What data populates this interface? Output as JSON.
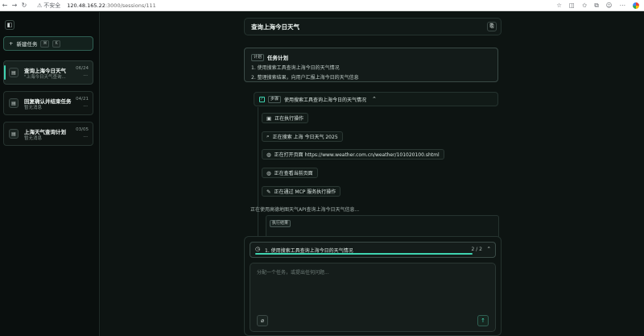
{
  "browser": {
    "security_label": "不安全",
    "url_host": "120.48.165.22",
    "url_rest": ":3000/sessions/111"
  },
  "sidebar": {
    "new_task_label": "新建任务",
    "shortcut_keys": [
      "⌘",
      "K"
    ],
    "sessions": [
      {
        "title": "查询上海今日天气",
        "subtitle": "\"上海今日天气查询...",
        "date": "06/24",
        "more": "...",
        "active": true
      },
      {
        "title": "回复确认并结束任务",
        "subtitle": "暂无消息",
        "date": "04/21",
        "more": "...",
        "active": false
      },
      {
        "title": "上海天气查询计划",
        "subtitle": "暂无消息",
        "date": "03/05",
        "more": "...",
        "active": false
      }
    ]
  },
  "main": {
    "title": "查询上海今日天气",
    "plan": {
      "tag": "计划",
      "heading": "任务计划",
      "items": [
        "1. 使用搜索工具查询上海今日的天气情况",
        "2. 整理搜索结果，向用户汇报上海今日的天气信息"
      ]
    },
    "step": {
      "tag": "步骤",
      "label": "使用搜索工具查询上海今日的天气情况"
    },
    "actions": [
      {
        "icon": "terminal-icon",
        "glyph": "▣",
        "label": "正在执行操作"
      },
      {
        "icon": "search-icon",
        "glyph": "⌕",
        "label": "正在搜索 上海 今日天气 2025"
      },
      {
        "icon": "globe-icon",
        "glyph": "◍",
        "label": "正在打开页面 https://www.weather.com.cn/weather/101020100.shtml"
      },
      {
        "icon": "globe-icon",
        "glyph": "◍",
        "label": "正在查看当前页面"
      },
      {
        "icon": "wrench-icon",
        "glyph": "✎",
        "label": "正在通过 MCP 服务执行操作"
      }
    ],
    "status_text": "正在使用高德地图天气API查询上海今日天气信息...",
    "result_tag": "执行结果"
  },
  "composer": {
    "progress_label": "1. 使用搜索工具查询上海今日的天气情况",
    "progress_count": "2 / 2",
    "progress_fraction": 1.0,
    "placeholder": "分配一个任务，或提出任何问题..."
  },
  "colors": {
    "accent": "#3fd3b0",
    "background": "#0d1412",
    "sidebar": "#0a0f0e"
  }
}
